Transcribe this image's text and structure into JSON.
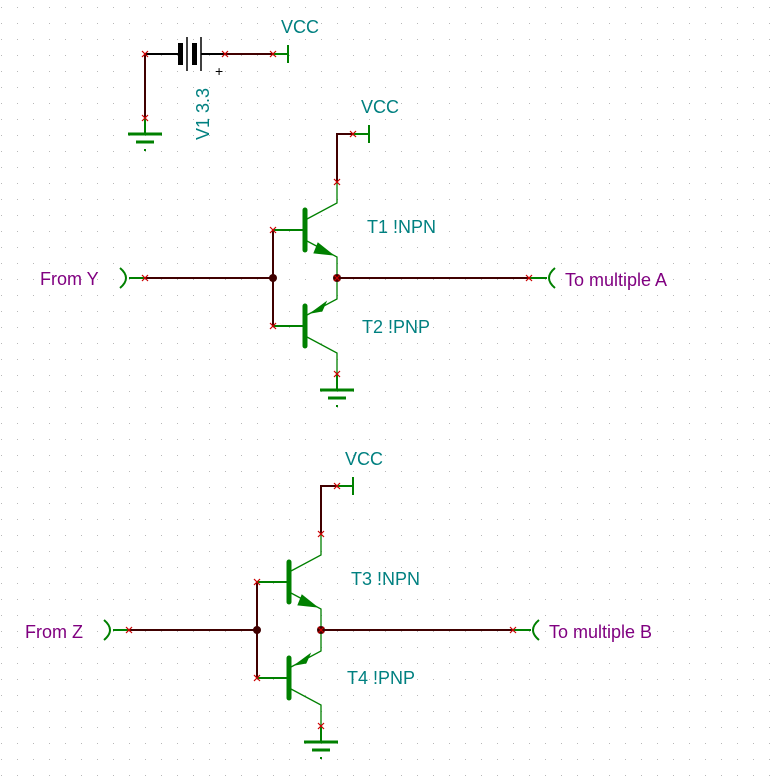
{
  "schematic": {
    "power_source": {
      "ref": "V1",
      "value": "3.3",
      "label": "V1 3.3",
      "polarity_mark": "+",
      "rail": "VCC"
    },
    "stages": [
      {
        "id": "stage-a",
        "input_port": "From Y",
        "output_port": "To multiple A",
        "rail": "VCC",
        "transistors": [
          {
            "ref": "T1",
            "type": "!NPN",
            "label": "T1 !NPN"
          },
          {
            "ref": "T2",
            "type": "!PNP",
            "label": "T2 !PNP"
          }
        ]
      },
      {
        "id": "stage-b",
        "input_port": "From Z",
        "output_port": "To multiple B",
        "rail": "VCC",
        "transistors": [
          {
            "ref": "T3",
            "type": "!NPN",
            "label": "T3 !NPN"
          },
          {
            "ref": "T4",
            "type": "!PNP",
            "label": "T4 !PNP"
          }
        ]
      }
    ],
    "icons": {
      "ground": "ground-icon",
      "power_rail": "vcc-rail-icon",
      "battery": "battery-icon",
      "port_in": "input-port-icon",
      "port_out": "output-port-icon",
      "junction": "junction-dot-icon",
      "pin": "pin-cross-icon"
    },
    "colors": {
      "wire": "#400000",
      "component": "#008000",
      "label": "#008080",
      "port_label": "#800080",
      "pin_marker": "#cc0000"
    }
  }
}
